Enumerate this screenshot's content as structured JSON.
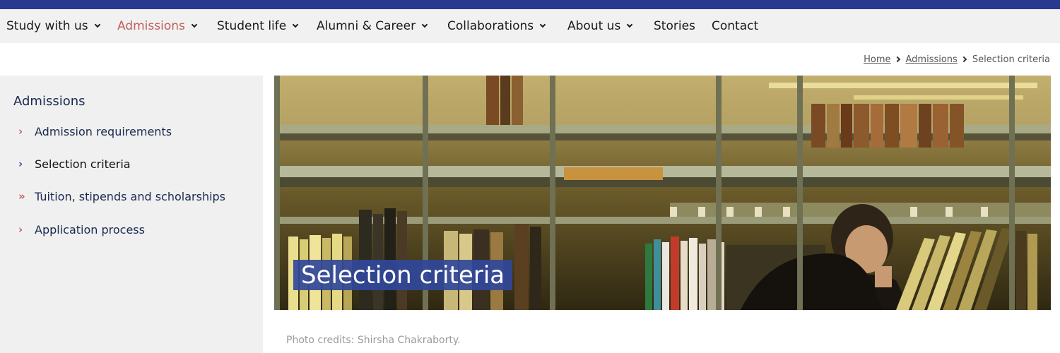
{
  "colors": {
    "topbar": "#273a8f",
    "nav_background": "#f1f1f1",
    "active_accent": "#c0605a",
    "title_overlay": "#31489a",
    "sidebar_background": "#f0f0f0"
  },
  "nav": {
    "items": [
      {
        "label": "Study with us",
        "dropdown": true
      },
      {
        "label": "Admissions",
        "dropdown": true,
        "active": true
      },
      {
        "label": "Student life",
        "dropdown": true
      },
      {
        "label": "Alumni & Career",
        "dropdown": true
      },
      {
        "label": "Collaborations",
        "dropdown": true
      },
      {
        "label": "About us",
        "dropdown": true
      },
      {
        "label": "Stories",
        "dropdown": false
      },
      {
        "label": "Contact",
        "dropdown": false
      }
    ]
  },
  "breadcrumb": {
    "items": [
      "Home",
      "Admissions"
    ],
    "current": "Selection criteria"
  },
  "sidebar": {
    "title": "Admissions",
    "items": [
      {
        "label": "Admission requirements",
        "icon": "chevron-right-icon"
      },
      {
        "label": "Selection criteria",
        "icon": "chevron-right-icon",
        "current": true
      },
      {
        "label": "Tuition, stipends and scholarships",
        "icon": "double-chevron-right-icon"
      },
      {
        "label": "Application process",
        "icon": "chevron-right-icon"
      }
    ]
  },
  "hero": {
    "title": "Selection criteria",
    "image": "library-bookshelves-photo"
  },
  "photo_credit": "Photo credits: Shirsha Chakraborty."
}
